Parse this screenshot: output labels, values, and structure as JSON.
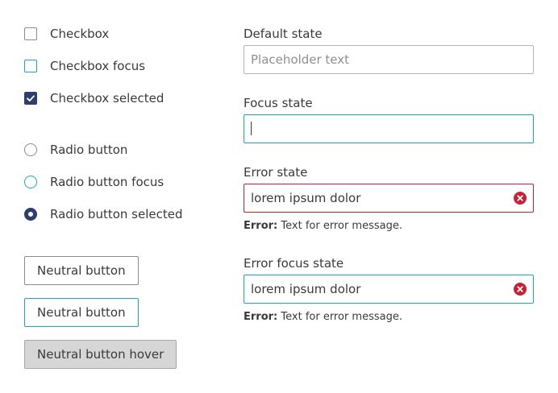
{
  "checkboxes": [
    {
      "label": "Checkbox",
      "state": "default"
    },
    {
      "label": "Checkbox focus",
      "state": "focus"
    },
    {
      "label": "Checkbox selected",
      "state": "checked"
    }
  ],
  "radios": [
    {
      "label": "Radio button",
      "state": "default"
    },
    {
      "label": "Radio button focus",
      "state": "focus"
    },
    {
      "label": "Radio button selected",
      "state": "checked"
    }
  ],
  "buttons": [
    {
      "label": "Neutral button",
      "state": "default"
    },
    {
      "label": "Neutral button",
      "state": "focus"
    },
    {
      "label": "Neutral button hover",
      "state": "hover"
    }
  ],
  "fields": {
    "default": {
      "label": "Default state",
      "placeholder": "Placeholder text"
    },
    "focus": {
      "label": "Focus state",
      "value": ""
    },
    "error": {
      "label": "Error state",
      "value": "lorem ipsum dolor",
      "error_prefix": "Error:",
      "error_text": "Text for error message."
    },
    "error_focus": {
      "label": "Error focus state",
      "value": "lorem ipsum dolor",
      "error_prefix": "Error:",
      "error_text": "Text for error message."
    }
  },
  "icons": {
    "checkmark": "check-icon",
    "error": "error-x-icon"
  },
  "colors": {
    "focus": "#1aa7c6",
    "selected": "#2c3e6b",
    "error": "#c42337",
    "hover_bg": "#d6d6d6"
  }
}
